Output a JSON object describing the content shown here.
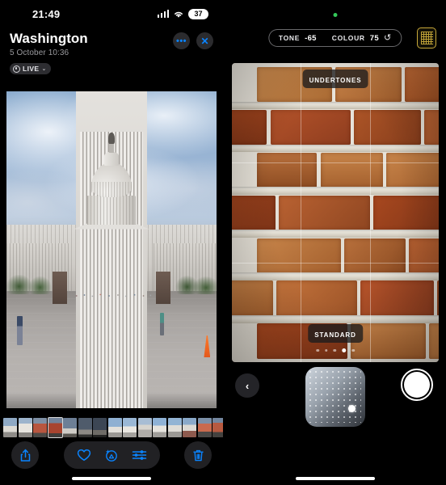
{
  "left_screen": {
    "status_bar": {
      "time": "21:49",
      "signal_icon": "cellular-signal-icon",
      "wifi_icon": "wifi-icon",
      "battery_level": "37"
    },
    "header": {
      "title": "Washington",
      "subtitle": "5 October  10:36",
      "more_button": "•••",
      "close_button": "✕",
      "live_badge": {
        "label": "LIVE",
        "chevron": "⌄"
      }
    },
    "photo": {
      "name": "us-capitol-building-photo",
      "alt": "United States Capitol dome with plaza and visitors"
    },
    "filmstrip": {
      "name": "photo-filmstrip",
      "selected_index": 3,
      "thumbnails": [
        {
          "type": "capitol-wide"
        },
        {
          "type": "capitol-columns"
        },
        {
          "type": "people-red"
        },
        {
          "type": "people-red-selected"
        },
        {
          "type": "monument"
        },
        {
          "type": "monument-dark"
        },
        {
          "type": "statue-dark"
        },
        {
          "type": "capitol-dome"
        },
        {
          "type": "capitol-dome-2"
        },
        {
          "type": "plaza"
        },
        {
          "type": "capitol-front"
        },
        {
          "type": "capitol-steps"
        },
        {
          "type": "capitol-crowd"
        },
        {
          "type": "people-group"
        },
        {
          "type": "people-group-2"
        }
      ]
    },
    "toolbar": {
      "share_label": "Share",
      "share_icon": "share-up-arrow-icon",
      "favourite_label": "Favourite",
      "favourite_icon": "heart-icon",
      "cleanup_label": "Clean Up",
      "cleanup_icon": "clean-up-icon",
      "adjust_label": "Adjust",
      "adjust_icon": "sliders-icon",
      "delete_label": "Delete",
      "delete_icon": "trash-icon"
    }
  },
  "right_screen": {
    "recording_indicator": "green-camera-active-dot",
    "controls": {
      "tone_label": "TONE",
      "tone_value": "-65",
      "colour_label": "COLOUR",
      "colour_value": "75",
      "reset_icon": "reset-arrow-icon"
    },
    "grid_button": {
      "name": "photographic-styles-grid-button",
      "colour": "#c8a93a"
    },
    "viewfinder": {
      "subject": "brick-wall",
      "grid_overlay": "rule-of-thirds",
      "top_label": "UNDERTONES",
      "bottom_label": "STANDARD",
      "page_dots_total": 5,
      "page_dots_active": 4
    },
    "bottom_controls": {
      "back_icon": "chevron-left-icon",
      "pad_name": "tone-colour-control-pad",
      "shutter_name": "shutter-button"
    }
  },
  "colors": {
    "accent_blue": "#0a84ff",
    "gold": "#c8a93a",
    "green": "#34c759",
    "background": "#000000"
  }
}
